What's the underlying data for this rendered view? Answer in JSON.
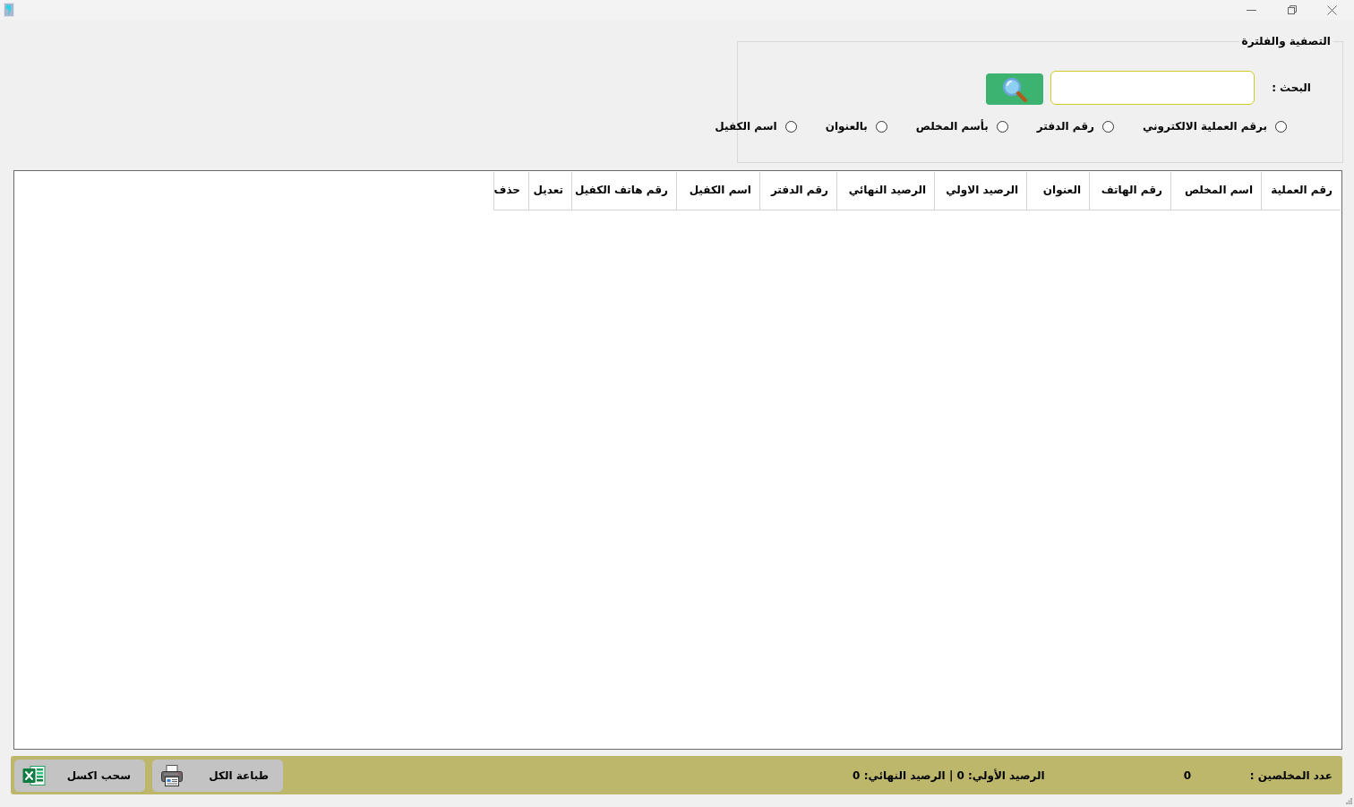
{
  "filter_panel": {
    "title": "التصفية والفلترة",
    "search_label": "البحث :",
    "search_options": [
      {
        "label": "برقم العملية الالكتروني",
        "selected": false
      },
      {
        "label": "رقم الدفتر",
        "selected": false
      },
      {
        "label": "بأسم المخلص",
        "selected": false
      },
      {
        "label": "بالعنوان",
        "selected": false
      },
      {
        "label": "اسم الكفيل",
        "selected": false
      }
    ]
  },
  "table": {
    "columns": [
      "رقم العملية",
      "اسم المخلص",
      "رقم الهاتف",
      "العنوان",
      "الرصيد الاولي",
      "الرصيد النهائي",
      "رقم الدفتر",
      "اسم الكفيل",
      "رقم هاتف الكفيل",
      "تعديل",
      "حذف"
    ]
  },
  "footer": {
    "count_label": "عدد المخلصين :",
    "count": "0",
    "totals": "الرصيد الأولي: 0 | الرصيد النهائي: 0",
    "buttons": [
      {
        "label": "طباعة الكل",
        "kind": "print"
      },
      {
        "label": "سحب اكسل",
        "kind": "excel"
      }
    ]
  }
}
